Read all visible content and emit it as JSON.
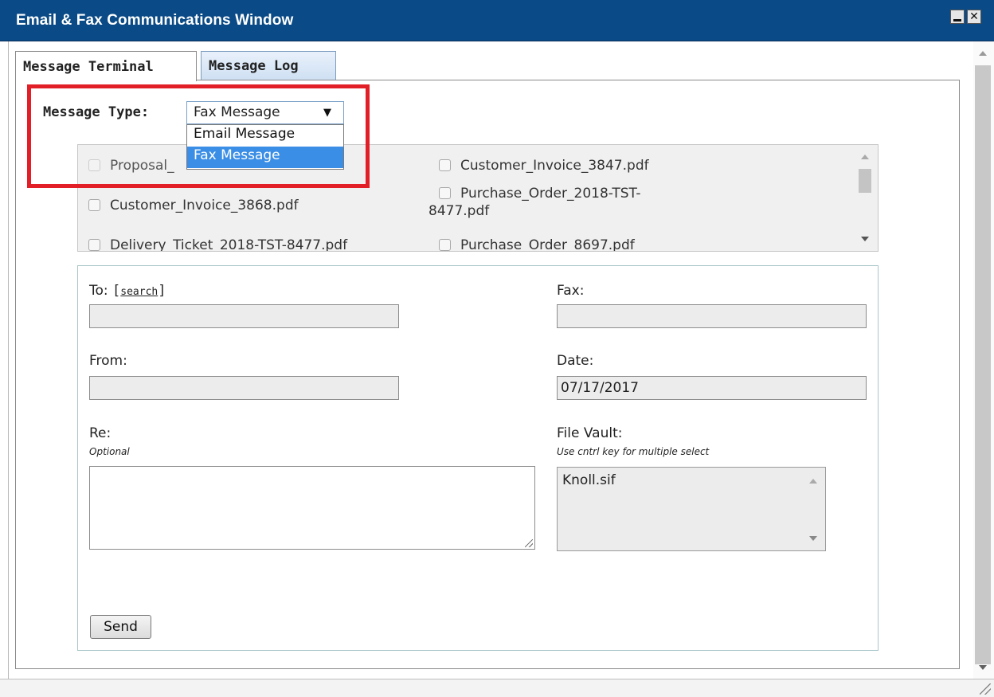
{
  "window": {
    "title": "Email & Fax Communications Window",
    "minimize_glyph": "",
    "close_glyph": "✕"
  },
  "tabs": [
    {
      "label": "Message Terminal",
      "active": true
    },
    {
      "label": "Message Log",
      "active": false
    }
  ],
  "message_type": {
    "label": "Message Type:",
    "selected": "Fax Message",
    "arrow": "▼",
    "options": [
      "Email Message",
      "Fax Message"
    ]
  },
  "attachments": [
    {
      "name": "Proposal_",
      "checked": false
    },
    {
      "name": "Customer_Invoice_3847.pdf",
      "checked": false
    },
    {
      "name": "Customer_Invoice_3868.pdf",
      "checked": false
    },
    {
      "name": "Purchase_Order_2018-TST-",
      "name_cont": "8477.pdf",
      "checked": false
    },
    {
      "name": "Delivery_Ticket_2018-TST-8477.pdf",
      "checked": false
    },
    {
      "name": "Purchase_Order_8697.pdf",
      "checked": false
    }
  ],
  "form": {
    "to_label": "To:",
    "search_open": "[",
    "search_link": "search",
    "search_close": "]",
    "to_value": "",
    "fax_label": "Fax:",
    "fax_value": "",
    "from_label": "From:",
    "from_value": "",
    "date_label": "Date:",
    "date_value": "07/17/2017",
    "re_label": "Re:",
    "re_hint": "Optional",
    "re_value": "",
    "vault_label": "File Vault:",
    "vault_hint": "Use cntrl key for multiple select",
    "vault_items": [
      "Knoll.sif"
    ],
    "send_label": "Send"
  },
  "colors": {
    "titlebar": "#0a4a86",
    "highlight": "#e21f26",
    "selected_option": "#3a8ee6"
  }
}
